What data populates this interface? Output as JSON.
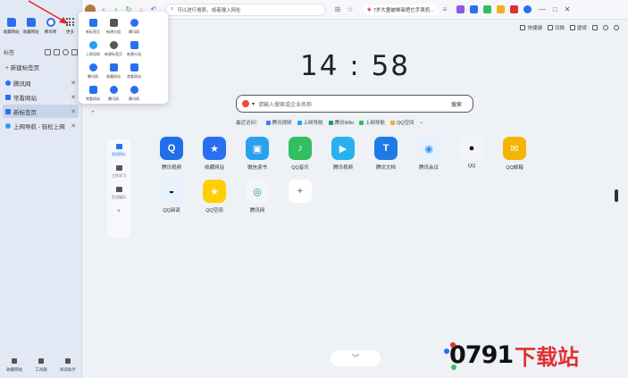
{
  "sidebar": {
    "top_apps": [
      {
        "label": "收藏网站",
        "icon": "folder-icon"
      },
      {
        "label": "收藏网站",
        "icon": "folder-icon"
      },
      {
        "label": "腾讯网",
        "icon": "compass-icon"
      },
      {
        "label": "更多",
        "icon": "grid-dots-icon"
      }
    ],
    "title": "标签",
    "new_tab": "+ 新建标签页",
    "tabs": [
      {
        "label": "腾讯网",
        "active": false,
        "color": "#2a6ff0"
      },
      {
        "label": "常看网站",
        "active": false,
        "color": "#2a6ff0"
      },
      {
        "label": "新标签页",
        "active": true,
        "color": "#2a6ff0"
      },
      {
        "label": "上网导航 - 轻松上网",
        "active": false,
        "color": "#2a6ff0"
      }
    ],
    "bottom": [
      {
        "label": "收藏网站"
      },
      {
        "label": "工具箱"
      },
      {
        "label": "阅读助手"
      }
    ]
  },
  "topbar": {
    "address_placeholder": "可以进行搜索，或者输入网址",
    "news": "7岁大童被绑架把它手表扔…",
    "win_min": "—",
    "win_max": "□",
    "win_close": "✕"
  },
  "util": [
    {
      "label": "快捷键"
    },
    {
      "label": "切换"
    },
    {
      "label": "壁纸"
    }
  ],
  "clock": "14 : 58",
  "search": {
    "placeholder": "请输入搜索或企业名称",
    "button": "搜索"
  },
  "quick": {
    "label": "最近访问：",
    "items": [
      {
        "label": "腾讯视频",
        "color": "#3a7bf0"
      },
      {
        "label": "上网导航",
        "color": "#2a9ff0"
      },
      {
        "label": "腾讯Wiki",
        "color": "#1aa060"
      },
      {
        "label": "上网导航",
        "color": "#2ac060"
      },
      {
        "label": "QQ空间",
        "color": "#f0b020"
      }
    ]
  },
  "categories": [
    {
      "label": "常用网址",
      "active": true
    },
    {
      "label": "工作学习",
      "active": false
    },
    {
      "label": "生活娱乐",
      "active": false
    },
    {
      "label": "+",
      "active": false
    }
  ],
  "apps": [
    {
      "label": "腾讯视频",
      "color": "#1f6fe8",
      "glyph": "Q"
    },
    {
      "label": "收藏网站",
      "color": "#2a6ff0",
      "glyph": "★"
    },
    {
      "label": "微信读书",
      "color": "#2aa0f0",
      "glyph": "▣"
    },
    {
      "label": "QQ音乐",
      "color": "#30c060",
      "glyph": "♪"
    },
    {
      "label": "腾讯视频",
      "color": "#28b0f0",
      "glyph": "▶"
    },
    {
      "label": "腾讯文档",
      "color": "#1f7ae8",
      "glyph": "T"
    },
    {
      "label": "腾讯会议",
      "color": "#e8f2ff",
      "glyph": "◉"
    },
    {
      "label": "QQ",
      "color": "#f3f5f9",
      "glyph": "🐧"
    },
    {
      "label": "QQ邮箱",
      "color": "#f5b400",
      "glyph": "✉"
    },
    {
      "label": "QQ阅读",
      "color": "#e8f2ff",
      "glyph": "◒"
    },
    {
      "label": "QQ空间",
      "color": "#ffd000",
      "glyph": "★"
    },
    {
      "label": "腾讯网",
      "color": "#f3f5f9",
      "glyph": "◎"
    },
    {
      "label": "",
      "color": "#ffffff",
      "glyph": "+"
    }
  ],
  "popup": [
    {
      "label": "新标签页",
      "color": "#2a6ff0"
    },
    {
      "label": "新建分组",
      "color": "#555"
    },
    {
      "label": "腾讯网",
      "color": "#2a6ff0"
    },
    {
      "label": "上网导航",
      "color": "#2a9ff0"
    },
    {
      "label": "新建标签页",
      "color": "#555"
    },
    {
      "label": "新建分组",
      "color": "#2a6ff0"
    },
    {
      "label": "腾讯网",
      "color": "#2a6ff0"
    },
    {
      "label": "收藏网站",
      "color": "#2a6ff0"
    },
    {
      "label": "常看网站",
      "color": "#2a6ff0"
    },
    {
      "label": "常看网站",
      "color": "#2a6ff0"
    },
    {
      "label": "腾讯网",
      "color": "#2a6ff0"
    },
    {
      "label": "腾讯网",
      "color": "#2a6ff0"
    },
    {
      "label": "+",
      "color": "#eee"
    }
  ],
  "watermark": {
    "number": "0791",
    "text": "下载站"
  },
  "bottom_pill": "︾"
}
